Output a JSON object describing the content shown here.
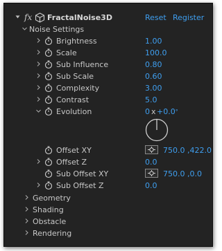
{
  "effect": {
    "fx_label": "fx",
    "name": "FractalNoise3D",
    "reset_label": "Reset",
    "register_label": "Register"
  },
  "noise_settings": {
    "label": "Noise Settings",
    "params": [
      {
        "label": "Brightness",
        "value": "1.00"
      },
      {
        "label": "Scale",
        "value": "100.0"
      },
      {
        "label": "Sub Influence",
        "value": "0.80"
      },
      {
        "label": "Sub Scale",
        "value": "0.60"
      },
      {
        "label": "Complexity",
        "value": "3.00"
      },
      {
        "label": "Contrast",
        "value": "5.0"
      }
    ],
    "evolution": {
      "label": "Evolution",
      "revolutions": "0",
      "separator": "x",
      "degrees": "+0.0",
      "degree_symbol": "°"
    },
    "offset_xy": {
      "label": "Offset XY",
      "value": "750.0 ,422.0"
    },
    "offset_z": {
      "label": "Offset Z",
      "value": "0.0"
    },
    "sub_offset_xy": {
      "label": "Sub Offset XY",
      "value": "750.0 ,0.0"
    },
    "sub_offset_z": {
      "label": "Sub Offset Z",
      "value": "0.0"
    }
  },
  "groups": [
    {
      "label": "Geometry"
    },
    {
      "label": "Shading"
    },
    {
      "label": "Obstacle"
    },
    {
      "label": "Rendering"
    }
  ],
  "colors": {
    "panel_bg": "#232323",
    "value_blue": "#3f9ff0",
    "label_text": "#c8c8c8"
  },
  "icons": {
    "stopwatch": "stopwatch-icon",
    "twirl_closed": "chevron-right-icon",
    "twirl_open": "chevron-down-icon",
    "effect_cube": "cube-icon",
    "point_picker": "crosshair-icon"
  }
}
